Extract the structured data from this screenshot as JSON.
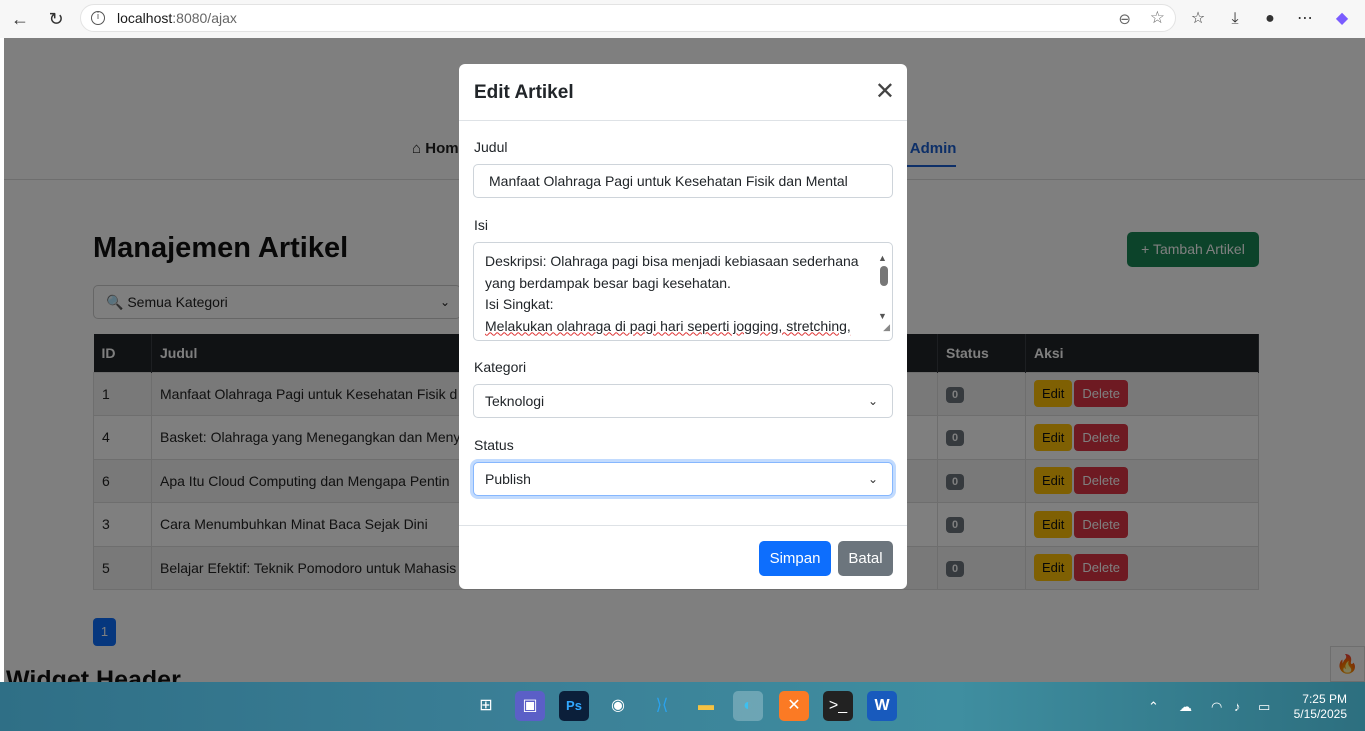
{
  "browser": {
    "url_host": "localhost",
    "url_rest": ":8080/ajax"
  },
  "nav": {
    "home": "Hom",
    "dashboard": "d Admin"
  },
  "page": {
    "title": "Manajemen Artikel",
    "add_button": "+ Tambah Artikel",
    "filter": "🔍 Semua Kategori",
    "widget_header": "Widget Header",
    "columns": [
      "ID",
      "Judul",
      "Status",
      "Aksi"
    ],
    "rows": [
      {
        "id": "1",
        "judul": "Manfaat Olahraga Pagi untuk Kesehatan Fisik d",
        "status": "0"
      },
      {
        "id": "4",
        "judul": "Basket: Olahraga yang Menegangkan dan Meny",
        "status": "0"
      },
      {
        "id": "6",
        "judul": "Apa Itu Cloud Computing dan Mengapa Pentin",
        "status": "0"
      },
      {
        "id": "3",
        "judul": "Cara Menumbuhkan Minat Baca Sejak Dini",
        "status": "0"
      },
      {
        "id": "5",
        "judul": "Belajar Efektif: Teknik Pomodoro untuk Mahasis",
        "status": "0"
      }
    ],
    "edit_label": "Edit",
    "delete_label": "Delete",
    "page_number": "1"
  },
  "modal": {
    "title": "Edit Artikel",
    "judul_label": "Judul",
    "judul_value": "Manfaat Olahraga Pagi untuk Kesehatan Fisik dan Mental",
    "isi_label": "Isi",
    "isi_lines": [
      "Deskripsi: Olahraga pagi bisa menjadi kebiasaan sederhana",
      "yang berdampak besar bagi kesehatan.",
      "Isi Singkat:",
      "Melakukan olahraga di pagi hari seperti jogging, stretching,"
    ],
    "kategori_label": "Kategori",
    "kategori_value": "Teknologi",
    "status_label": "Status",
    "status_value": "Publish",
    "save": "Simpan",
    "cancel": "Batal"
  },
  "clock": {
    "time": "7:25 PM",
    "date": "5/15/2025"
  }
}
